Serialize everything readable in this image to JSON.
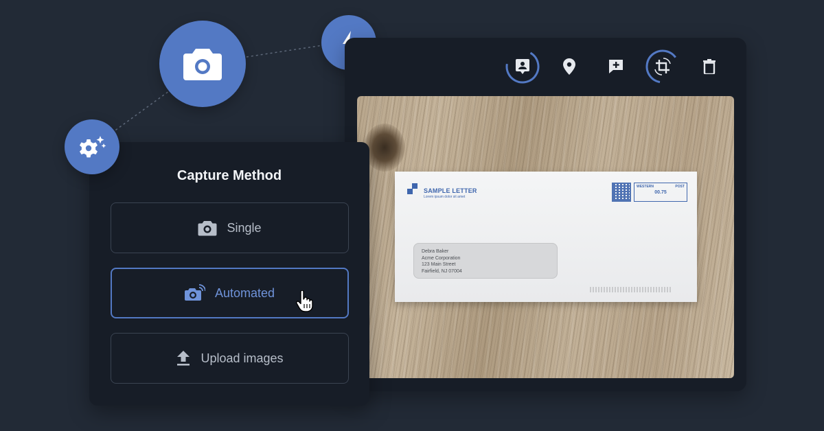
{
  "capture": {
    "title": "Capture Method",
    "options": [
      {
        "label": "Single",
        "icon": "camera-icon",
        "selected": false
      },
      {
        "label": "Automated",
        "icon": "auto-camera-icon",
        "selected": true
      },
      {
        "label": "Upload images",
        "icon": "upload-icon",
        "selected": false
      }
    ]
  },
  "toolbar": {
    "tools": [
      "contact-icon",
      "location-pin-icon",
      "add-comment-icon",
      "crop-rotate-icon",
      "trash-icon"
    ]
  },
  "badges": [
    "camera-icon",
    "flash-icon",
    "gear-sparkle-icon"
  ],
  "envelope": {
    "logo_title": "SAMPLE LETTER",
    "logo_subtitle": "Lorem ipsum dolor sit amet",
    "postage_brand": "WESTERN",
    "postage_post": "POST",
    "postage_value": "00.75",
    "address": {
      "name": "Debra Baker",
      "company": "Acme Corporation",
      "street": "123 Main Street",
      "city": "Fairfield, NJ 07004"
    }
  },
  "colors": {
    "background": "#222a36",
    "panel": "#171d27",
    "accent": "#5379c4",
    "accent_text": "#6f93da",
    "option_border": "#3b4452"
  }
}
